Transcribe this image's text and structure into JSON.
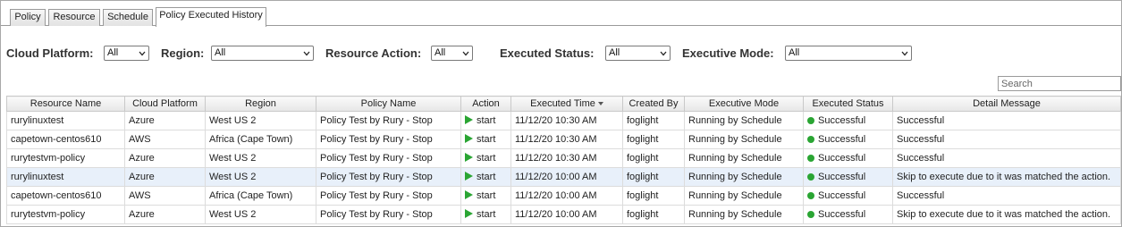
{
  "tabs": [
    {
      "label": "Policy"
    },
    {
      "label": "Resource"
    },
    {
      "label": "Schedule"
    },
    {
      "label": "Policy Executed History",
      "active": true
    }
  ],
  "filters": {
    "cloud_platform": {
      "label": "Cloud Platform:",
      "value": "All"
    },
    "region": {
      "label": "Region:",
      "value": "All"
    },
    "resource_action": {
      "label": "Resource Action:",
      "value": "All"
    },
    "executed_status": {
      "label": "Executed Status:",
      "value": "All"
    },
    "executive_mode": {
      "label": "Executive Mode:",
      "value": "All"
    }
  },
  "search": {
    "placeholder": "Search"
  },
  "table": {
    "columns": [
      "Resource Name",
      "Cloud Platform",
      "Region",
      "Policy Name",
      "Action",
      "Executed Time",
      "Created By",
      "Executive Mode",
      "Executed Status",
      "Detail Message"
    ],
    "sorted_column": "Executed Time",
    "rows": [
      {
        "resource": "rurylinuxtest",
        "platform": "Azure",
        "region": "West US 2",
        "policy": "Policy Test by Rury - Stop",
        "action": "start",
        "time": "11/12/20 10:30 AM",
        "created_by": "foglight",
        "mode": "Running by Schedule",
        "status": "Successful",
        "message": "Successful"
      },
      {
        "resource": "capetown-centos610",
        "platform": "AWS",
        "region": "Africa (Cape Town)",
        "policy": "Policy Test by Rury - Stop",
        "action": "start",
        "time": "11/12/20 10:30 AM",
        "created_by": "foglight",
        "mode": "Running by Schedule",
        "status": "Successful",
        "message": "Successful"
      },
      {
        "resource": "rurytestvm-policy",
        "platform": "Azure",
        "region": "West US 2",
        "policy": "Policy Test by Rury - Stop",
        "action": "start",
        "time": "11/12/20 10:30 AM",
        "created_by": "foglight",
        "mode": "Running by Schedule",
        "status": "Successful",
        "message": "Successful"
      },
      {
        "resource": "rurylinuxtest",
        "platform": "Azure",
        "region": "West US 2",
        "policy": "Policy Test by Rury - Stop",
        "action": "start",
        "time": "11/12/20 10:00 AM",
        "created_by": "foglight",
        "mode": "Running by Schedule",
        "status": "Successful",
        "message": "Skip to execute due to it was matched the action."
      },
      {
        "resource": "capetown-centos610",
        "platform": "AWS",
        "region": "Africa (Cape Town)",
        "policy": "Policy Test by Rury - Stop",
        "action": "start",
        "time": "11/12/20 10:00 AM",
        "created_by": "foglight",
        "mode": "Running by Schedule",
        "status": "Successful",
        "message": "Successful"
      },
      {
        "resource": "rurytestvm-policy",
        "platform": "Azure",
        "region": "West US 2",
        "policy": "Policy Test by Rury - Stop",
        "action": "start",
        "time": "11/12/20 10:00 AM",
        "created_by": "foglight",
        "mode": "Running by Schedule",
        "status": "Successful",
        "message": "Skip to execute due to it was matched the action."
      }
    ]
  },
  "colors": {
    "success": "#2aa533",
    "highlight_row": "#e8f0fa"
  },
  "icons": {
    "action": "play-icon",
    "status": "status-dot-icon",
    "select": "chevron-down-icon",
    "sort": "sort-desc-icon"
  }
}
